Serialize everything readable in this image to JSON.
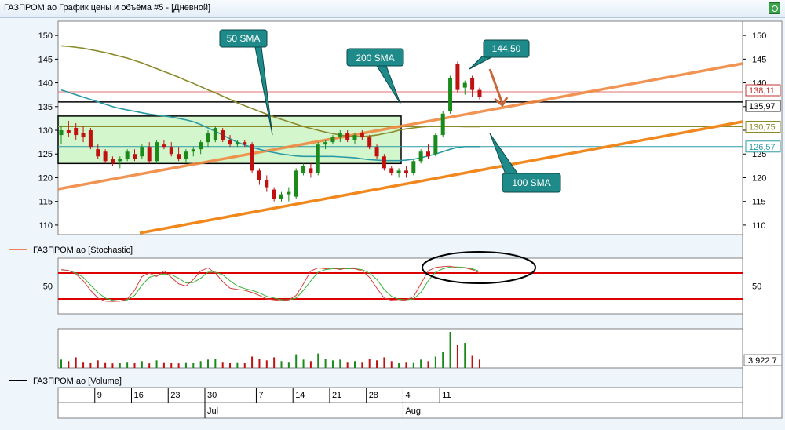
{
  "window": {
    "title": "ГАЗПРОМ ао График цены и объёма #5 - [Дневной]"
  },
  "panes": {
    "stochastic_label": "ГАЗПРОМ ао [Stochastic]",
    "volume_label": "ГАЗПРОМ ао [Volume]",
    "volume_value": "3 922 7"
  },
  "price_axis": {
    "ticks": [
      "150",
      "145",
      "140",
      "135",
      "130",
      "125",
      "120",
      "115",
      "110"
    ],
    "tags": {
      "red": "138,11",
      "black": "135,97",
      "olive": "130,75",
      "teal": "126,57"
    }
  },
  "stoch_axis": {
    "ticks": [
      "50"
    ]
  },
  "date_axis": {
    "days": [
      "9",
      "16",
      "23",
      "30",
      "7",
      "14",
      "21",
      "28",
      "4",
      "11"
    ],
    "months": [
      "Jul",
      "Aug"
    ]
  },
  "callouts": {
    "sma50": "50 SMA",
    "sma200": "200 SMA",
    "peak": "144.50",
    "sma100": "100 SMA"
  },
  "colors": {
    "up_candle": "#1a8a1a",
    "down_candle": "#c01010",
    "sma200": "#8a8a2a",
    "sma100": "#2a9aa6",
    "trendline": "#f08840",
    "callout": "#1f8a8a",
    "overbought": "#dd0000"
  },
  "chart_data": {
    "type": "candlestick",
    "price_range": [
      108,
      153
    ],
    "candles": [
      {
        "o": 129.0,
        "h": 131.0,
        "l": 127.0,
        "c": 130.0
      },
      {
        "o": 130.0,
        "h": 132.0,
        "l": 128.5,
        "c": 129.5
      },
      {
        "o": 130.5,
        "h": 131.5,
        "l": 128.0,
        "c": 129.0
      },
      {
        "o": 129.5,
        "h": 131.0,
        "l": 127.5,
        "c": 128.5
      },
      {
        "o": 130.0,
        "h": 130.5,
        "l": 126.0,
        "c": 126.5
      },
      {
        "o": 126.0,
        "h": 127.0,
        "l": 124.0,
        "c": 124.5
      },
      {
        "o": 125.5,
        "h": 126.0,
        "l": 123.0,
        "c": 123.5
      },
      {
        "o": 124.0,
        "h": 124.5,
        "l": 122.5,
        "c": 123.0
      },
      {
        "o": 123.5,
        "h": 124.5,
        "l": 122.0,
        "c": 124.0
      },
      {
        "o": 124.0,
        "h": 126.0,
        "l": 123.5,
        "c": 125.5
      },
      {
        "o": 125.0,
        "h": 126.0,
        "l": 123.5,
        "c": 124.0
      },
      {
        "o": 124.5,
        "h": 127.0,
        "l": 124.0,
        "c": 126.5
      },
      {
        "o": 126.5,
        "h": 127.5,
        "l": 123.0,
        "c": 123.5
      },
      {
        "o": 123.5,
        "h": 128.0,
        "l": 123.0,
        "c": 127.5
      },
      {
        "o": 127.0,
        "h": 128.0,
        "l": 126.0,
        "c": 126.5
      },
      {
        "o": 126.5,
        "h": 127.5,
        "l": 124.5,
        "c": 125.0
      },
      {
        "o": 125.0,
        "h": 126.5,
        "l": 123.5,
        "c": 124.0
      },
      {
        "o": 124.0,
        "h": 126.0,
        "l": 123.0,
        "c": 125.5
      },
      {
        "o": 125.5,
        "h": 126.5,
        "l": 124.5,
        "c": 126.0
      },
      {
        "o": 126.0,
        "h": 128.0,
        "l": 125.0,
        "c": 127.5
      },
      {
        "o": 127.5,
        "h": 130.0,
        "l": 126.5,
        "c": 129.5
      },
      {
        "o": 128.0,
        "h": 131.0,
        "l": 127.5,
        "c": 130.5
      },
      {
        "o": 130.0,
        "h": 130.5,
        "l": 127.5,
        "c": 128.0
      },
      {
        "o": 128.0,
        "h": 129.0,
        "l": 126.5,
        "c": 127.0
      },
      {
        "o": 127.0,
        "h": 128.0,
        "l": 126.5,
        "c": 127.5
      },
      {
        "o": 127.5,
        "h": 128.0,
        "l": 126.5,
        "c": 127.0
      },
      {
        "o": 127.0,
        "h": 127.5,
        "l": 121.0,
        "c": 121.5
      },
      {
        "o": 121.5,
        "h": 122.0,
        "l": 118.5,
        "c": 119.5
      },
      {
        "o": 119.5,
        "h": 120.5,
        "l": 117.0,
        "c": 118.0
      },
      {
        "o": 117.5,
        "h": 118.0,
        "l": 115.0,
        "c": 115.5
      },
      {
        "o": 115.5,
        "h": 117.0,
        "l": 115.0,
        "c": 116.5
      },
      {
        "o": 116.5,
        "h": 118.0,
        "l": 115.0,
        "c": 117.0
      },
      {
        "o": 116.0,
        "h": 122.0,
        "l": 115.5,
        "c": 121.5
      },
      {
        "o": 121.0,
        "h": 123.0,
        "l": 120.5,
        "c": 122.5
      },
      {
        "o": 122.0,
        "h": 123.0,
        "l": 120.0,
        "c": 121.0
      },
      {
        "o": 121.0,
        "h": 127.5,
        "l": 120.5,
        "c": 127.0
      },
      {
        "o": 127.0,
        "h": 128.0,
        "l": 126.0,
        "c": 127.5
      },
      {
        "o": 127.5,
        "h": 129.0,
        "l": 127.0,
        "c": 128.5
      },
      {
        "o": 128.5,
        "h": 130.0,
        "l": 127.5,
        "c": 129.5
      },
      {
        "o": 129.5,
        "h": 130.0,
        "l": 127.5,
        "c": 128.0
      },
      {
        "o": 128.0,
        "h": 129.5,
        "l": 127.0,
        "c": 129.0
      },
      {
        "o": 129.5,
        "h": 130.0,
        "l": 128.0,
        "c": 128.5
      },
      {
        "o": 128.5,
        "h": 129.0,
        "l": 126.0,
        "c": 126.5
      },
      {
        "o": 126.5,
        "h": 127.0,
        "l": 124.0,
        "c": 124.5
      },
      {
        "o": 124.5,
        "h": 125.0,
        "l": 121.5,
        "c": 122.0
      },
      {
        "o": 122.0,
        "h": 122.5,
        "l": 120.5,
        "c": 121.0
      },
      {
        "o": 121.0,
        "h": 122.0,
        "l": 120.0,
        "c": 121.5
      },
      {
        "o": 121.5,
        "h": 122.5,
        "l": 120.0,
        "c": 121.0
      },
      {
        "o": 121.0,
        "h": 124.0,
        "l": 120.5,
        "c": 123.5
      },
      {
        "o": 123.5,
        "h": 126.0,
        "l": 123.0,
        "c": 125.5
      },
      {
        "o": 125.5,
        "h": 127.0,
        "l": 124.0,
        "c": 124.5
      },
      {
        "o": 125.0,
        "h": 129.5,
        "l": 124.5,
        "c": 129.0
      },
      {
        "o": 129.0,
        "h": 134.0,
        "l": 128.5,
        "c": 133.5
      },
      {
        "o": 134.0,
        "h": 141.5,
        "l": 133.5,
        "c": 141.0
      },
      {
        "o": 144.0,
        "h": 144.5,
        "l": 138.0,
        "c": 138.5
      },
      {
        "o": 139.0,
        "h": 140.5,
        "l": 137.5,
        "c": 140.0
      },
      {
        "o": 141.0,
        "h": 141.5,
        "l": 137.0,
        "c": 138.5
      },
      {
        "o": 138.5,
        "h": 139.0,
        "l": 136.5,
        "c": 137.0
      }
    ],
    "volume": [
      22,
      18,
      28,
      16,
      14,
      20,
      15,
      12,
      13,
      16,
      14,
      18,
      12,
      20,
      15,
      13,
      12,
      15,
      14,
      18,
      22,
      24,
      16,
      14,
      15,
      13,
      30,
      24,
      20,
      28,
      18,
      16,
      36,
      22,
      18,
      38,
      24,
      20,
      22,
      16,
      18,
      16,
      24,
      20,
      28,
      18,
      14,
      16,
      15,
      22,
      18,
      30,
      42,
      95,
      60,
      66,
      32,
      22
    ],
    "stochastic": {
      "k": [
        88,
        86,
        78,
        62,
        40,
        22,
        15,
        14,
        15,
        20,
        40,
        72,
        80,
        72,
        85,
        70,
        55,
        50,
        65,
        85,
        92,
        80,
        60,
        45,
        42,
        40,
        35,
        28,
        20,
        18,
        16,
        18,
        28,
        55,
        85,
        92,
        90,
        92,
        88,
        92,
        90,
        85,
        70,
        45,
        22,
        17,
        16,
        18,
        25,
        55,
        85,
        93,
        95,
        96,
        92,
        92,
        88,
        80
      ],
      "d": [
        85,
        85,
        80,
        70,
        52,
        35,
        22,
        17,
        15,
        18,
        28,
        52,
        70,
        75,
        78,
        76,
        68,
        57,
        58,
        68,
        82,
        82,
        76,
        62,
        50,
        44,
        40,
        34,
        26,
        22,
        18,
        18,
        22,
        40,
        62,
        82,
        88,
        90,
        90,
        90,
        90,
        88,
        80,
        65,
        42,
        26,
        19,
        18,
        20,
        35,
        62,
        82,
        90,
        94,
        94,
        93,
        90,
        84
      ],
      "overbought": 80,
      "oversold": 20
    },
    "sma200": [
      147.8,
      147.7,
      147.5,
      147.3,
      147.0,
      146.7,
      146.4,
      146.0,
      145.6,
      145.2,
      144.7,
      144.2,
      143.6,
      143.0,
      142.4,
      141.8,
      141.2,
      140.5,
      139.9,
      139.2,
      138.5,
      137.9,
      137.2,
      136.5,
      135.8,
      135.2,
      134.6,
      134.0,
      133.4,
      132.8,
      132.3,
      131.8,
      131.3,
      130.8,
      130.4,
      130.0,
      129.6,
      129.3,
      129.0,
      128.8,
      128.7,
      128.7,
      128.8,
      129.0,
      129.3,
      129.6,
      130.0,
      130.3,
      130.5,
      130.7,
      130.8,
      130.8,
      130.8,
      130.8,
      130.8,
      130.75,
      130.75,
      130.75
    ],
    "sma100": [
      138.5,
      138.0,
      137.5,
      137.0,
      136.5,
      136.0,
      135.5,
      135.0,
      134.6,
      134.3,
      134.0,
      133.7,
      133.4,
      133.2,
      133.0,
      132.8,
      132.5,
      132.2,
      131.8,
      131.2,
      130.5,
      129.8,
      129.0,
      128.2,
      127.5,
      126.9,
      126.4,
      126.0,
      125.6,
      125.3,
      125.0,
      124.8,
      124.6,
      124.5,
      124.5,
      124.5,
      124.5,
      124.5,
      124.4,
      124.3,
      124.2,
      124.0,
      123.8,
      123.7,
      123.6,
      123.6,
      123.6,
      123.7,
      123.9,
      124.2,
      124.6,
      125.0,
      125.5,
      126.0,
      126.4,
      126.57,
      126.57,
      126.57
    ],
    "price_levels": [
      138.11,
      135.97,
      130.75,
      126.57
    ],
    "consolidation_range": [
      123.0,
      133.0
    ]
  }
}
